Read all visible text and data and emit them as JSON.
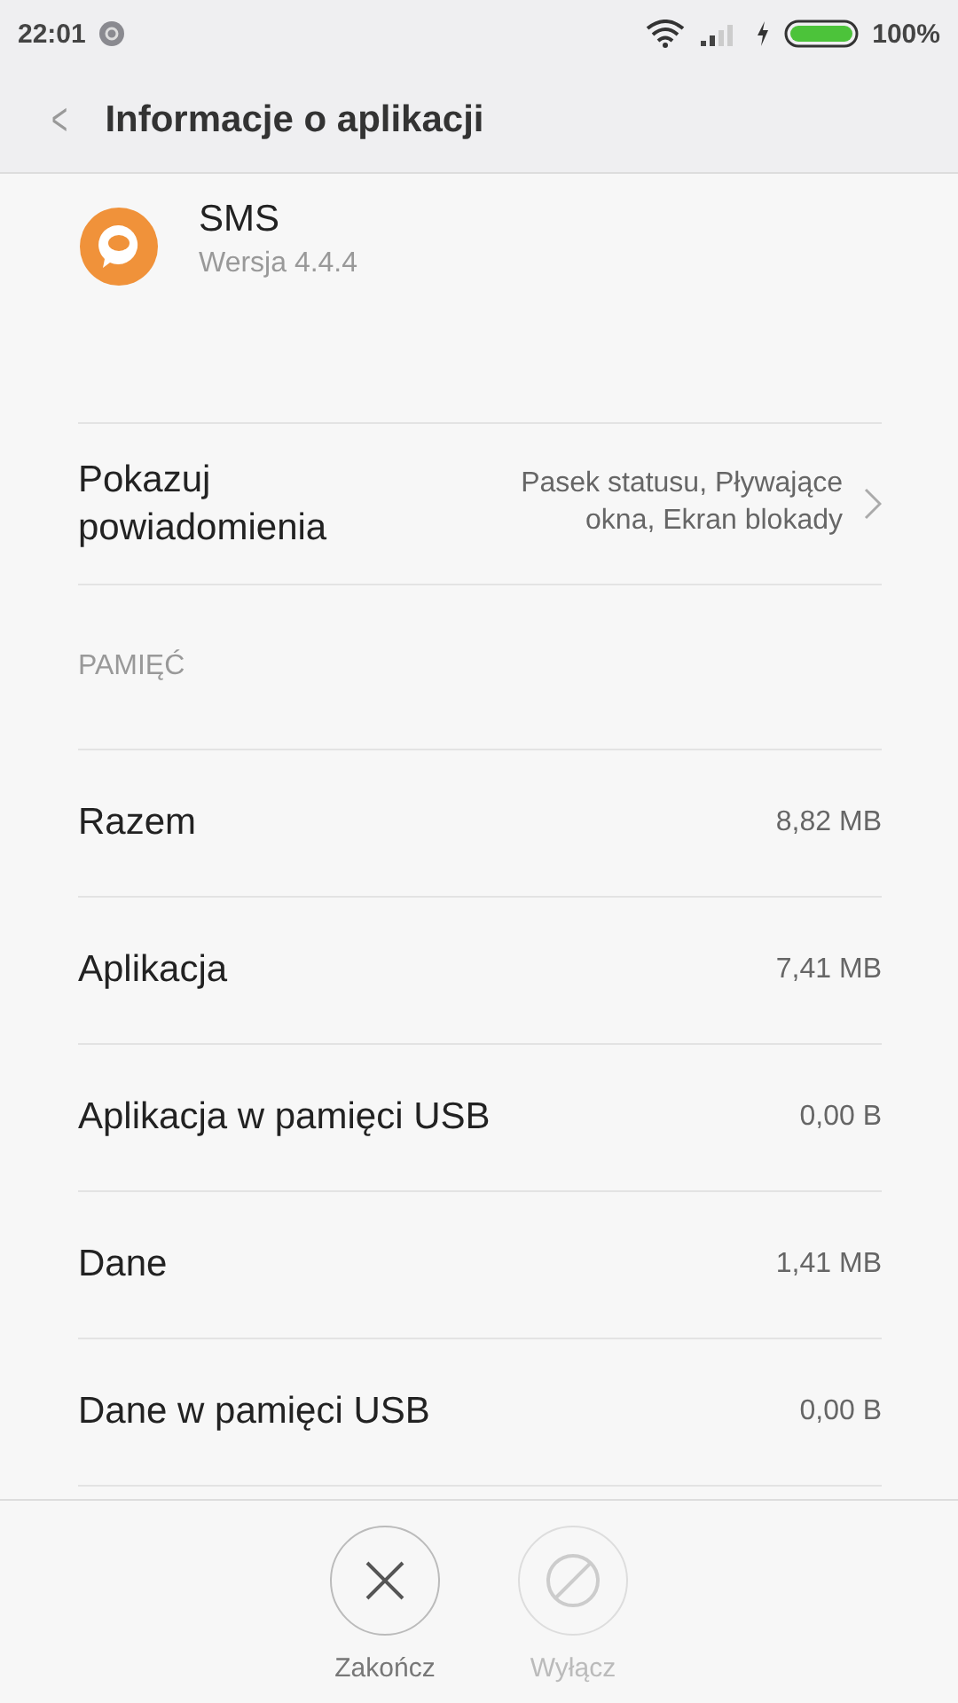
{
  "status_bar": {
    "time": "22:01",
    "battery": "100%"
  },
  "header": {
    "back": "<",
    "title": "Informacje o aplikacji"
  },
  "app": {
    "name": "SMS",
    "version": "Wersja 4.4.4"
  },
  "notifications": {
    "label": "Pokazuj powiadomienia",
    "value": "Pasek statusu, Pływające okna, Ekran blokady"
  },
  "storage": {
    "heading": "PAMIĘĆ",
    "rows": [
      {
        "label": "Razem",
        "value": "8,82 MB"
      },
      {
        "label": "Aplikacja",
        "value": "7,41 MB"
      },
      {
        "label": "Aplikacja w pamięci USB",
        "value": "0,00 B"
      },
      {
        "label": "Dane",
        "value": "1,41 MB"
      },
      {
        "label": "Dane w pamięci USB",
        "value": "0,00 B"
      }
    ]
  },
  "actions": [
    {
      "kind": "stop",
      "label": "Zakończ",
      "disabled": false
    },
    {
      "kind": "disable",
      "label": "Wyłącz",
      "disabled": true
    }
  ]
}
